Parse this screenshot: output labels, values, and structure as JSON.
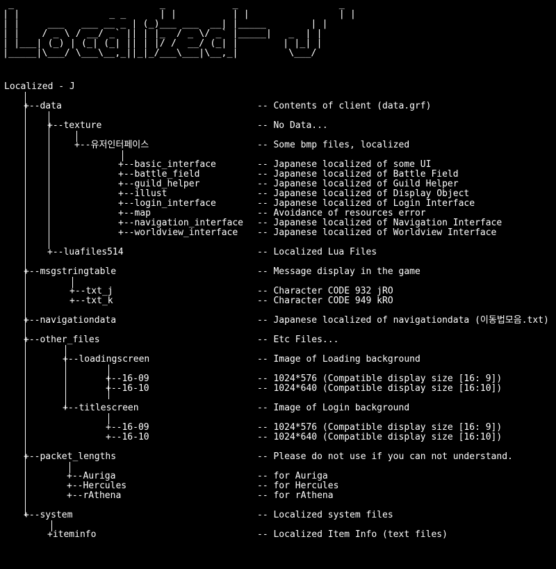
{
  "banner": {
    "logo_art": " _                          _            _                  _\n| |                _ _      | |          | |                | |\n| |     ___   ___ __ _ | (_)___ ___  __| |_____        | |\n| |    / _ \\ / __/ _` || | |_  / _ \\/ _` |_____|   _  | |\n| |___| (_) | (_| (_| || | |/ /  __/ (_| |        | |_| |\n|_____|\\___/ \\___\\__,_||_|_/___\\___|\\__,_|         \\___/"
  },
  "root": {
    "label": "Localized - J"
  },
  "rows": [
    {
      "id": "data",
      "label": "+--data",
      "desc": "-- Contents of client (data.grf)"
    },
    {
      "id": "texture",
      "label": "+--texture",
      "desc": "-- No Data..."
    },
    {
      "id": "ui",
      "label": "+--유저인터페이스",
      "desc": "-- Some bmp files, localized"
    },
    {
      "id": "basic_interface",
      "label": "+--basic_interface",
      "desc": "-- Japanese localized of some UI"
    },
    {
      "id": "battle_field",
      "label": "+--battle_field",
      "desc": "-- Japanese localized of Battle Field"
    },
    {
      "id": "guild_helper",
      "label": "+--guild_helper",
      "desc": "-- Japanese localized of Guild Helper"
    },
    {
      "id": "illust",
      "label": "+--illust",
      "desc": "-- Japanese localized of Display Object"
    },
    {
      "id": "login_interface",
      "label": "+--login_interface",
      "desc": "-- Japanese localized of Login Interface"
    },
    {
      "id": "map",
      "label": "+--map",
      "desc": "-- Avoidance of resources error"
    },
    {
      "id": "navigation_interface",
      "label": "+--navigation_interface",
      "desc": "-- Japanese localized of Navigation Interface"
    },
    {
      "id": "worldview_interface",
      "label": "+--worldview_interface",
      "desc": "-- Japanese localized of Worldview Interface"
    },
    {
      "id": "luafiles514",
      "label": "+--luafiles514",
      "desc": "-- Localized Lua Files"
    },
    {
      "id": "msgstringtable",
      "label": "+--msgstringtable",
      "desc": "-- Message display in the game"
    },
    {
      "id": "txt_j",
      "label": "+--txt_j",
      "desc": "-- Character CODE 932 jRO"
    },
    {
      "id": "txt_k",
      "label": "+--txt_k",
      "desc": "-- Character CODE 949 kRO"
    },
    {
      "id": "navigationdata",
      "label": "+--navigationdata",
      "desc": "-- Japanese localized of navigationdata (이동법모음.txt)"
    },
    {
      "id": "other_files",
      "label": "+--other_files",
      "desc": "-- Etc Files..."
    },
    {
      "id": "loadingscreen",
      "label": "+--loadingscreen",
      "desc": "-- Image of Loading background"
    },
    {
      "id": "ls_16_09",
      "label": "+--16-09",
      "desc": "-- 1024*576 (Compatible display size [16: 9])"
    },
    {
      "id": "ls_16_10",
      "label": "+--16-10",
      "desc": "-- 1024*640 (Compatible display size [16:10])"
    },
    {
      "id": "titlescreen",
      "label": "+--titlescreen",
      "desc": "-- Image of Login background"
    },
    {
      "id": "ts_16_09",
      "label": "+--16-09",
      "desc": "-- 1024*576 (Compatible display size [16: 9])"
    },
    {
      "id": "ts_16_10",
      "label": "+--16-10",
      "desc": "-- 1024*640 (Compatible display size [16:10])"
    },
    {
      "id": "packet_lengths",
      "label": "+--packet_lengths",
      "desc": "-- Please do not use if you can not understand."
    },
    {
      "id": "auriga",
      "label": "+--Auriga",
      "desc": "-- for Auriga"
    },
    {
      "id": "hercules",
      "label": "+--Hercules",
      "desc": "-- for Hercules"
    },
    {
      "id": "rathena",
      "label": "+--rAthena",
      "desc": "-- for rAthena"
    },
    {
      "id": "system",
      "label": "+--system",
      "desc": "-- Localized system files"
    },
    {
      "id": "iteminfo",
      "label": "+iteminfo",
      "desc": "-- Localized Item Info (text files)"
    }
  ]
}
